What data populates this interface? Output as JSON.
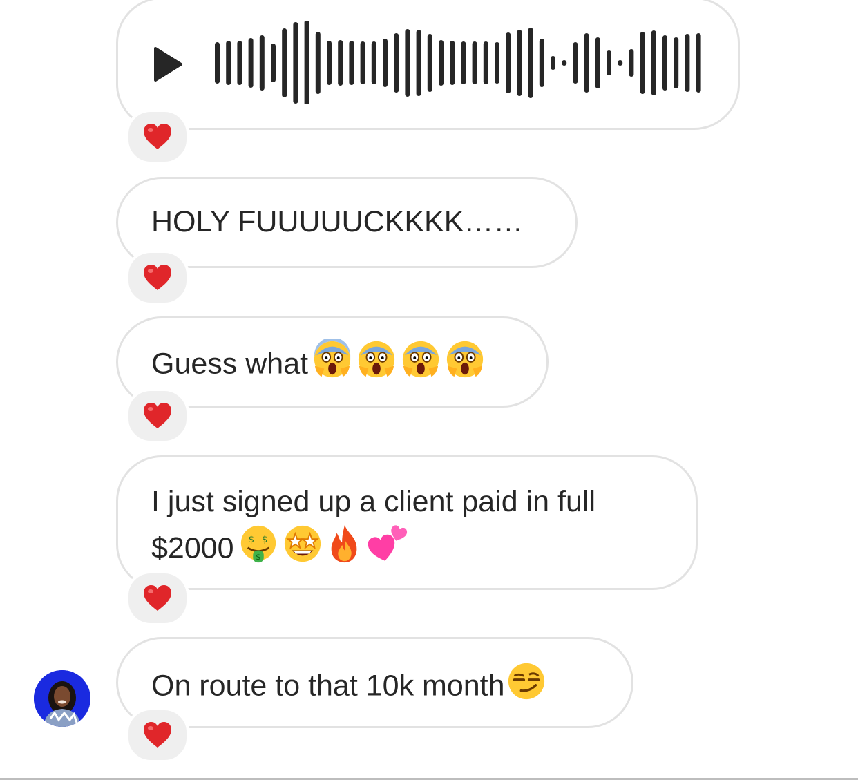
{
  "messages": [
    {
      "id": "voice",
      "type": "voice",
      "play_icon": "play-icon",
      "reaction": "heart-emoji"
    },
    {
      "id": "holy",
      "type": "text",
      "text": "HOLY FUUUUUCKKKK……",
      "reaction": "heart-emoji"
    },
    {
      "id": "guess",
      "type": "text",
      "text": "Guess what",
      "emojis": [
        "screaming-face",
        "screaming-face",
        "screaming-face",
        "screaming-face"
      ],
      "reaction": "heart-emoji"
    },
    {
      "id": "client",
      "type": "text",
      "lines": [
        "I just signed up a client paid in full",
        "$2000"
      ],
      "emojis": [
        "money-mouth-face",
        "star-struck-face",
        "fire",
        "two-hearts"
      ],
      "reaction": "heart-emoji"
    },
    {
      "id": "route",
      "type": "text",
      "text": "On route to that 10k month",
      "emojis": [
        "smirking-face"
      ],
      "reaction": "heart-emoji"
    }
  ],
  "sender": {
    "avatar": "avatar"
  },
  "colors": {
    "bubble_border": "#e2e2e2",
    "text": "#262626",
    "reaction_bg": "#efefef",
    "heart": "#e0262a",
    "waveform": "#262626"
  }
}
